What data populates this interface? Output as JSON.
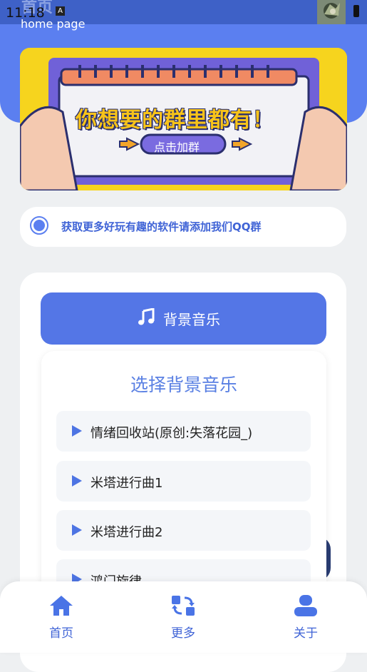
{
  "status_bar": {
    "time": "11:18",
    "notification_badge": "A"
  },
  "header": {
    "title": "首页",
    "subtitle": "home page"
  },
  "banner": {
    "headline": "你想要的群里都有！",
    "button_label": "点击加群"
  },
  "notice": {
    "text": "获取更多好玩有趣的软件请添加我们QQ群"
  },
  "music_button": {
    "label": "背景音乐",
    "icon": "music-note-icon"
  },
  "music_popup": {
    "title": "选择背景音乐",
    "songs": [
      {
        "name": "情绪回收站(原创:失落花园_)"
      },
      {
        "name": "米塔进行曲1"
      },
      {
        "name": "米塔进行曲2"
      },
      {
        "name": "鸿门旋律"
      }
    ]
  },
  "tabbar": {
    "items": [
      {
        "label": "首页",
        "icon": "home-icon"
      },
      {
        "label": "更多",
        "icon": "swap-icon"
      },
      {
        "label": "关于",
        "icon": "user-icon"
      }
    ]
  },
  "colors": {
    "accent": "#5b7ff0",
    "button": "#5476e6",
    "tab_label": "#3f63d6",
    "banner_yellow": "#f5d21f"
  }
}
